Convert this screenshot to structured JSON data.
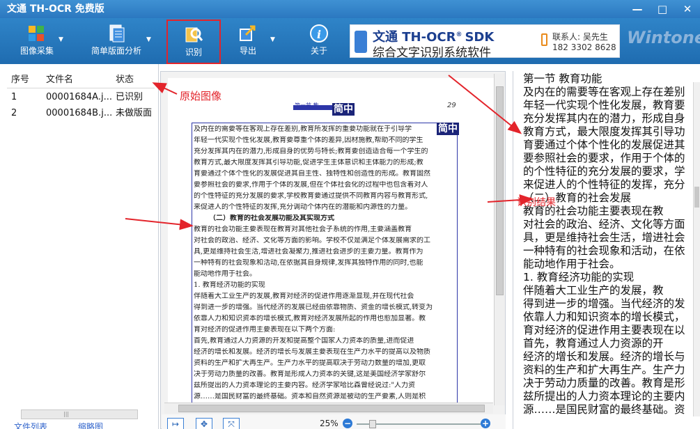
{
  "app": {
    "title": "文通 TH-OCR 免费版"
  },
  "window_controls": {
    "minimize": "—",
    "maximize": "□",
    "close": "✕"
  },
  "toolbar": {
    "items": [
      {
        "label": "图像采集",
        "icon": "image-acquire-icon",
        "has_dropdown": true
      },
      {
        "label": "简单版面分析",
        "icon": "layout-analysis-icon",
        "has_dropdown": true
      },
      {
        "label": "识别",
        "icon": "recognize-icon",
        "has_dropdown": false,
        "highlighted": true
      },
      {
        "label": "导出",
        "icon": "export-icon",
        "has_dropdown": true
      },
      {
        "label": "关于",
        "icon": "about-icon",
        "has_dropdown": false
      }
    ],
    "dropdown_glyph": "▼"
  },
  "banner": {
    "line1": "文通 TH-OCR",
    "registered": "®",
    "sdk": "SDK",
    "line2": "综合文字识别系统软件",
    "contact_label": "联系人: 吴先生",
    "phone": "182 3302 8628",
    "brand": "Wintone"
  },
  "file_list": {
    "headers": [
      "序号",
      "文件名",
      "状态"
    ],
    "rows": [
      {
        "index": "1",
        "name": "00001684A.j...",
        "status": "已识别"
      },
      {
        "index": "2",
        "name": "00001684B.j...",
        "status": "未做版面"
      }
    ],
    "bottom_tabs": [
      "文件列表",
      "缩略图"
    ],
    "scroll_glyph": "|||"
  },
  "image_view": {
    "annotation": "原始图像",
    "heading_left": "第一节  教",
    "tag": "简中",
    "page_number": "29",
    "lines": [
      "及内在的需要等在客观上存在差别,教育所发挥的重要功能就在于引导学",
      "年轻一代实现个性化发展,教育要尊重个体的差异,因材施教,帮助不同的学生",
      "充分发挥其内在的潜力,形成自身的优势与特长;教育要创造适合每一个学生的",
      "教育方式,最大限度发挥其引导功能,促进学生主体意识和主体能力的形成;教",
      "育要通过个体个性化的发展促进其自主性、独特性和创造性的形成。教育固然",
      "要参照社会的要求,作用于个体的发展,但在个体社会化的过程中也包含着对人",
      "的个性特征的充分发展的要求,学校教育要通过提供不同教育内容与教育形式,",
      "来促进人的个性特征的发挥,充分调动个体内在的潜能和内源性的力量。",
      "（二）教育的社会发展功能及其实现方式",
      "    教育的社会功能主要表现在教育对其他社会子系统的作用,主要涵盖教育",
      "对社会的政治、经济、文化等方面的影响。学校不仅是满足个体发展需求的工",
      "具,更是维持社会生活,增进社会凝聚力,推进社会进步的主要力量。教育作为",
      "一种特有的社会现象和活动,在依据其自身规律,发挥其独特作用的同时,也能",
      "能动地作用于社会。",
      "    1. 教育经济功能的实现",
      "    伴随着大工业生产的发展,教育对经济的促进作用逐渐显现,并在现代社会",
      "得到进一步的增强。当代经济的发展已经由依靠物质、资金的增长模式,转变为",
      "依靠人力和知识资本的增长模式,教育对经济发展所起的作用也愈加显著。教",
      "育对经济的促进作用主要表现在以下两个方面:",
      "    首先,教育通过人力资源的开发和提高整个国家人力资本的质量,进而促进",
      "经济的增长和发展。经济的增长与发展主要表现在生产力水平的提高以及物质",
      "资料的生产和扩大再生产。生产力水平的提高取决于劳动力数量的增加,更取",
      "决于劳动力质量的改善。教育是形成人力资本的关键,这是美国经济学家舒尔",
      "兹所提出的人力资本理论的主要内容。经济学家哈比森曾经说过:\"人力资",
      "源……是国民财富的最终基础。资本和自然资源是被动的生产要素,人则是积"
    ],
    "zoom": "25%",
    "zoom_minus": "−",
    "zoom_plus": "+",
    "bottom_glyphs": [
      "↦",
      "✥",
      "⤧"
    ]
  },
  "result_view": {
    "annotation": "识别结果",
    "lines": [
      "第一节  教育功能",
      "及内在的需要等在客观上存在差别",
      "年轻一代实现个性化发展，教育要",
      "充分发挥其内在的潜力，形成自身",
      "教育方式，最大限度发挥其引导功",
      "育要通过个体个性化的发展促进其",
      "要参照社会的要求，作用于个体的",
      "的个性特征的充分发展的要求，学",
      "来促进人的个性特征的发挥，充分",
      "        （二）教育的社会发展",
      "    教育的社会功能主要表现在教",
      "对社会的政治、经济、文化等方面",
      "具，更是维持社会生活，增进社会",
      "一种特有的社会现象和活动，在依",
      "能动地作用于社会。",
      "    1. 教育经济功能的实现",
      "    伴随着大工业生产的发展，教",
      "得到进一步的增强。当代经济的发",
      "依靠人力和知识资本的增长模式，",
      "育对经济的促进作用主要表现在以",
      "    首先，教育通过人力资源的开",
      "经济的增长和发展。经济的增长与",
      "资料的生产和扩大再生产。生产力",
      "决于劳动力质量的改善。教育是形",
      "兹所提出的人力资本理论的主要内",
      "源……是国民财富的最终基础。资"
    ]
  },
  "colors": {
    "title_bar": "#2b78c0",
    "toolbar": "#1f6cb0",
    "highlight": "#e3242b",
    "page_frame": "#2d36a8",
    "annotation": "#e3242b"
  }
}
